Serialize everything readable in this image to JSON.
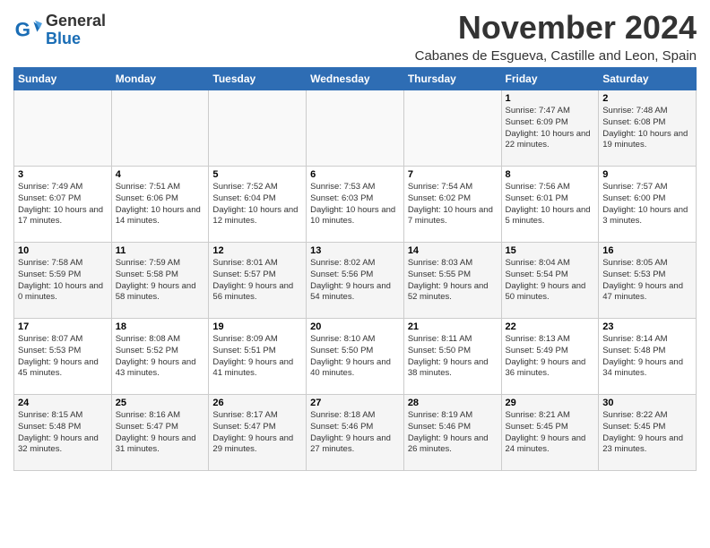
{
  "header": {
    "logo_general": "General",
    "logo_blue": "Blue",
    "month_title": "November 2024",
    "location": "Cabanes de Esgueva, Castille and Leon, Spain"
  },
  "weekdays": [
    "Sunday",
    "Monday",
    "Tuesday",
    "Wednesday",
    "Thursday",
    "Friday",
    "Saturday"
  ],
  "weeks": [
    [
      {
        "day": "",
        "info": ""
      },
      {
        "day": "",
        "info": ""
      },
      {
        "day": "",
        "info": ""
      },
      {
        "day": "",
        "info": ""
      },
      {
        "day": "",
        "info": ""
      },
      {
        "day": "1",
        "info": "Sunrise: 7:47 AM\nSunset: 6:09 PM\nDaylight: 10 hours and 22 minutes."
      },
      {
        "day": "2",
        "info": "Sunrise: 7:48 AM\nSunset: 6:08 PM\nDaylight: 10 hours and 19 minutes."
      }
    ],
    [
      {
        "day": "3",
        "info": "Sunrise: 7:49 AM\nSunset: 6:07 PM\nDaylight: 10 hours and 17 minutes."
      },
      {
        "day": "4",
        "info": "Sunrise: 7:51 AM\nSunset: 6:06 PM\nDaylight: 10 hours and 14 minutes."
      },
      {
        "day": "5",
        "info": "Sunrise: 7:52 AM\nSunset: 6:04 PM\nDaylight: 10 hours and 12 minutes."
      },
      {
        "day": "6",
        "info": "Sunrise: 7:53 AM\nSunset: 6:03 PM\nDaylight: 10 hours and 10 minutes."
      },
      {
        "day": "7",
        "info": "Sunrise: 7:54 AM\nSunset: 6:02 PM\nDaylight: 10 hours and 7 minutes."
      },
      {
        "day": "8",
        "info": "Sunrise: 7:56 AM\nSunset: 6:01 PM\nDaylight: 10 hours and 5 minutes."
      },
      {
        "day": "9",
        "info": "Sunrise: 7:57 AM\nSunset: 6:00 PM\nDaylight: 10 hours and 3 minutes."
      }
    ],
    [
      {
        "day": "10",
        "info": "Sunrise: 7:58 AM\nSunset: 5:59 PM\nDaylight: 10 hours and 0 minutes."
      },
      {
        "day": "11",
        "info": "Sunrise: 7:59 AM\nSunset: 5:58 PM\nDaylight: 9 hours and 58 minutes."
      },
      {
        "day": "12",
        "info": "Sunrise: 8:01 AM\nSunset: 5:57 PM\nDaylight: 9 hours and 56 minutes."
      },
      {
        "day": "13",
        "info": "Sunrise: 8:02 AM\nSunset: 5:56 PM\nDaylight: 9 hours and 54 minutes."
      },
      {
        "day": "14",
        "info": "Sunrise: 8:03 AM\nSunset: 5:55 PM\nDaylight: 9 hours and 52 minutes."
      },
      {
        "day": "15",
        "info": "Sunrise: 8:04 AM\nSunset: 5:54 PM\nDaylight: 9 hours and 50 minutes."
      },
      {
        "day": "16",
        "info": "Sunrise: 8:05 AM\nSunset: 5:53 PM\nDaylight: 9 hours and 47 minutes."
      }
    ],
    [
      {
        "day": "17",
        "info": "Sunrise: 8:07 AM\nSunset: 5:53 PM\nDaylight: 9 hours and 45 minutes."
      },
      {
        "day": "18",
        "info": "Sunrise: 8:08 AM\nSunset: 5:52 PM\nDaylight: 9 hours and 43 minutes."
      },
      {
        "day": "19",
        "info": "Sunrise: 8:09 AM\nSunset: 5:51 PM\nDaylight: 9 hours and 41 minutes."
      },
      {
        "day": "20",
        "info": "Sunrise: 8:10 AM\nSunset: 5:50 PM\nDaylight: 9 hours and 40 minutes."
      },
      {
        "day": "21",
        "info": "Sunrise: 8:11 AM\nSunset: 5:50 PM\nDaylight: 9 hours and 38 minutes."
      },
      {
        "day": "22",
        "info": "Sunrise: 8:13 AM\nSunset: 5:49 PM\nDaylight: 9 hours and 36 minutes."
      },
      {
        "day": "23",
        "info": "Sunrise: 8:14 AM\nSunset: 5:48 PM\nDaylight: 9 hours and 34 minutes."
      }
    ],
    [
      {
        "day": "24",
        "info": "Sunrise: 8:15 AM\nSunset: 5:48 PM\nDaylight: 9 hours and 32 minutes."
      },
      {
        "day": "25",
        "info": "Sunrise: 8:16 AM\nSunset: 5:47 PM\nDaylight: 9 hours and 31 minutes."
      },
      {
        "day": "26",
        "info": "Sunrise: 8:17 AM\nSunset: 5:47 PM\nDaylight: 9 hours and 29 minutes."
      },
      {
        "day": "27",
        "info": "Sunrise: 8:18 AM\nSunset: 5:46 PM\nDaylight: 9 hours and 27 minutes."
      },
      {
        "day": "28",
        "info": "Sunrise: 8:19 AM\nSunset: 5:46 PM\nDaylight: 9 hours and 26 minutes."
      },
      {
        "day": "29",
        "info": "Sunrise: 8:21 AM\nSunset: 5:45 PM\nDaylight: 9 hours and 24 minutes."
      },
      {
        "day": "30",
        "info": "Sunrise: 8:22 AM\nSunset: 5:45 PM\nDaylight: 9 hours and 23 minutes."
      }
    ]
  ]
}
